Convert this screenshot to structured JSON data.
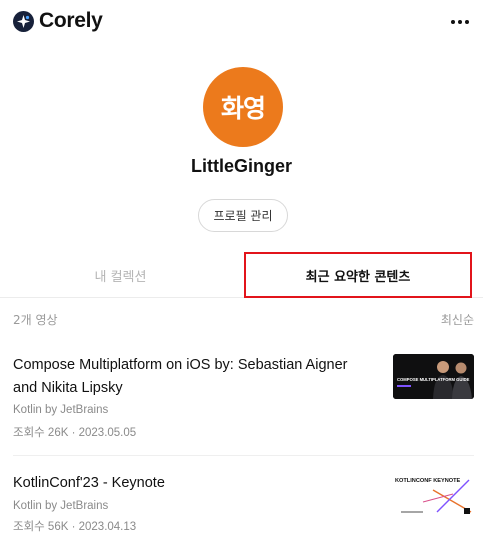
{
  "app": {
    "name": "Corely"
  },
  "profile": {
    "avatar_text": "화영",
    "username": "LittleGinger",
    "manage_label": "프로필 관리"
  },
  "tabs": [
    {
      "label": "내 컬렉션",
      "active": false
    },
    {
      "label": "최근 요약한 콘텐츠",
      "active": true
    }
  ],
  "list": {
    "count_label": "2개 영상",
    "sort_label": "최신순"
  },
  "videos": [
    {
      "title": "Compose Multiplatform on iOS by: Sebastian Aigner and Nikita Lipsky",
      "channel": "Kotlin by JetBrains",
      "stats": "조회수 26K · 2023.05.05",
      "thumb_text": "COMPOSE MULTIPLATFORM GUIDE"
    },
    {
      "title": "KotlinConf'23 - Keynote",
      "channel": "Kotlin by JetBrains",
      "stats": "조회수 56K · 2023.04.13",
      "thumb_text": "KOTLINCONF KEYNOTE"
    }
  ],
  "colors": {
    "avatar": "#ec7a1c",
    "highlight": "#e2141b",
    "logo": "#17213a"
  }
}
